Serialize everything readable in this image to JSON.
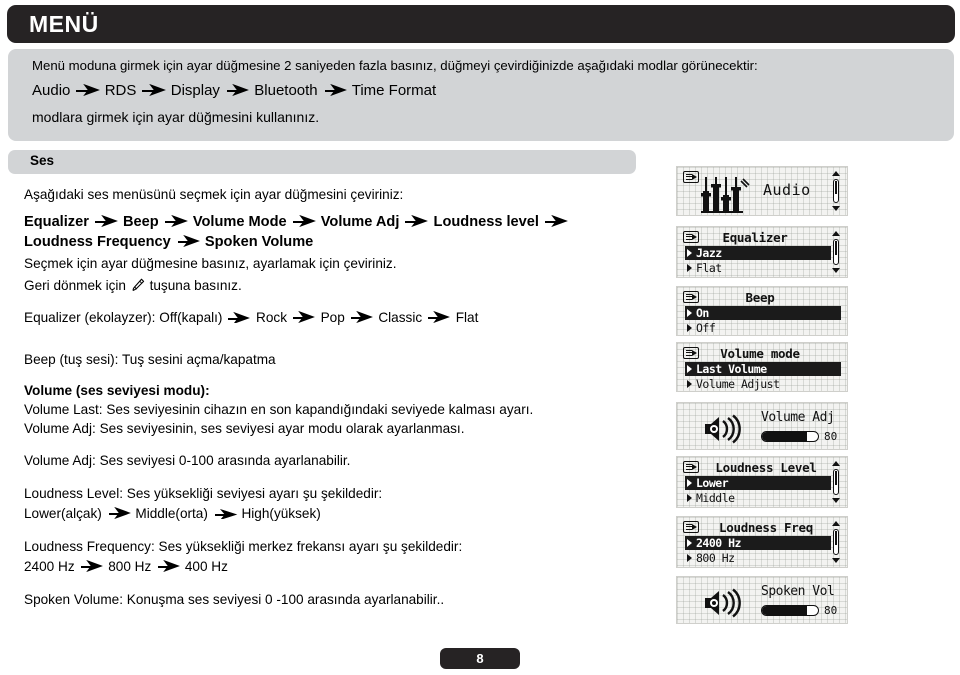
{
  "header": {
    "title": "MENÜ"
  },
  "intro": {
    "line1": "Menü moduna girmek için ayar düğmesine 2 saniyeden fazla basınız, düğmeyi çevirdiğinizde aşağıdaki modlar görünecektir:",
    "chain": [
      "Audio",
      "RDS",
      "Display",
      "Bluetooth",
      "Time Format"
    ],
    "line3": "modlara girmek için ayar düğmesini kullanınız."
  },
  "section": {
    "title": "Ses"
  },
  "body": {
    "intro_line": "Aşağıdaki ses menüsünü seçmek için ayar düğmesini çeviriniz:",
    "menu_chain_1": [
      "Equalizer",
      "Beep",
      "Volume Mode",
      "Volume Adj",
      "Loudness level"
    ],
    "menu_chain_2": [
      "Loudness Frequency",
      "Spoken Volume"
    ],
    "select_line": "Seçmek için ayar düğmesine basınız, ayarlamak için çeviriniz.",
    "back_line_pre": "Geri dönmek için",
    "back_line_post": "tuşuna basınız.",
    "equalizer_label": "Equalizer (ekolayzer):",
    "equalizer_options": [
      "Off(kapalı)",
      "Rock",
      "Pop",
      "Classic",
      "Flat"
    ],
    "beep_label": "Beep (tuş sesi):",
    "beep_text": "Tuş sesini açma/kapatma",
    "volume_mode_label": "Volume (ses seviyesi modu):",
    "volume_last_text": "Volume Last: Ses seviyesinin cihazın en son kapandığındaki seviyede kalması ayarı.",
    "volume_adj_text": "Volume Adj: Ses seviyesinin, ses seviyesi ayar modu olarak ayarlanması.",
    "volume_adj_label": "Volume Adj:",
    "volume_adj_desc": "Ses seviyesi  0-100 arasında ayarlanabilir.",
    "loudness_level_label": "Loudness Level:",
    "loudness_level_desc": "Ses yüksekliği seviyesi ayarı şu şekildedir:",
    "loudness_level_options": [
      "Lower(alçak)",
      "Middle(orta)",
      "High(yüksek)"
    ],
    "loudness_freq_label": "Loudness Frequency:",
    "loudness_freq_desc": "Ses yüksekliği merkez frekansı ayarı şu şekildedir:",
    "loudness_freq_options": [
      "2400 Hz",
      "800 Hz",
      "400 Hz"
    ],
    "spoken_volume_label": "Spoken Volume:",
    "spoken_volume_desc": "Konuşma ses seviyesi  0 -100 arasında ayarlanabilir.."
  },
  "screens": [
    {
      "id": "audio",
      "kind": "icon-center",
      "icon": "equalizer-bars-icon",
      "text": "Audio",
      "scrollbar": true
    },
    {
      "id": "equalizer",
      "kind": "list",
      "title": "Equalizer",
      "rows": [
        {
          "label": "Jazz",
          "selected": true
        },
        {
          "label": "Flat",
          "selected": false
        }
      ],
      "scrollbar": true
    },
    {
      "id": "beep",
      "kind": "list",
      "title": "Beep",
      "rows": [
        {
          "label": "On",
          "selected": true
        },
        {
          "label": "Off",
          "selected": false
        }
      ],
      "scrollbar": false
    },
    {
      "id": "volume-mode",
      "kind": "list",
      "title": "Volume mode",
      "rows": [
        {
          "label": "Last Volume",
          "selected": true
        },
        {
          "label": "Volume Adjust",
          "selected": false
        }
      ],
      "scrollbar": false
    },
    {
      "id": "volume-adj",
      "kind": "slider",
      "icon": "speaker-icon",
      "title": "Volume Adj",
      "value": "80",
      "fill_percent": 80
    },
    {
      "id": "loudness-level",
      "kind": "list",
      "title": "Loudness Level",
      "rows": [
        {
          "label": "Lower",
          "selected": true
        },
        {
          "label": "Middle",
          "selected": false
        }
      ],
      "scrollbar": true
    },
    {
      "id": "loudness-freq",
      "kind": "list",
      "title": "Loudness Freq",
      "rows": [
        {
          "label": "2400 Hz",
          "selected": true
        },
        {
          "label": "800  Hz",
          "selected": false
        }
      ],
      "scrollbar": true
    },
    {
      "id": "spoken-vol",
      "kind": "slider",
      "icon": "speaker-icon",
      "title": "Spoken Vol",
      "value": "80",
      "fill_percent": 80
    }
  ],
  "footer": {
    "page": "8"
  },
  "colors": {
    "header_bg": "#262324",
    "panel_bg": "#d2d4d6",
    "lcd_bg": "#f3f3f1",
    "ink": "#111111"
  }
}
